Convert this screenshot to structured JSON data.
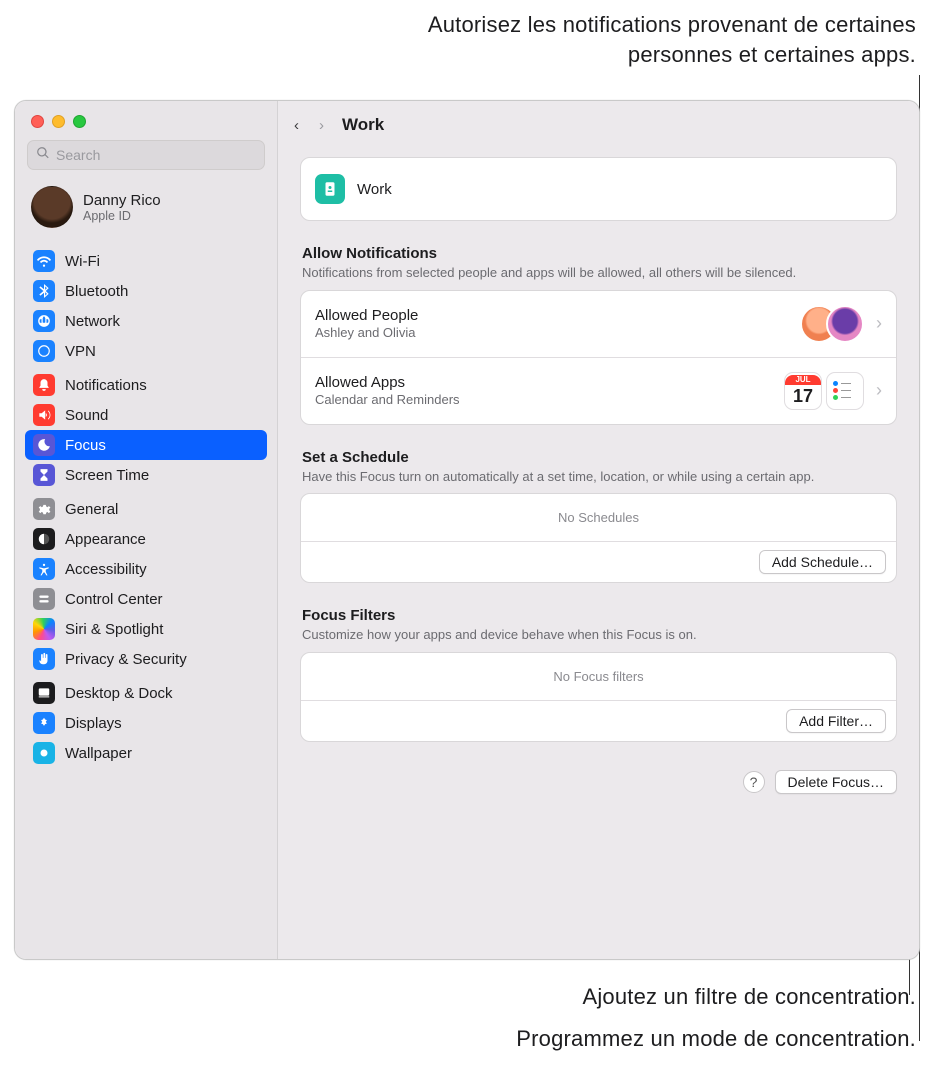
{
  "callouts": {
    "top": "Autorisez les notifications provenant de certaines personnes et certaines apps.",
    "filter": "Ajoutez un filtre de concentration.",
    "schedule": "Programmez un mode de concentration."
  },
  "search": {
    "placeholder": "Search"
  },
  "account": {
    "name": "Danny Rico",
    "sub": "Apple ID"
  },
  "sidebar": {
    "items": [
      {
        "label": "Wi-Fi"
      },
      {
        "label": "Bluetooth"
      },
      {
        "label": "Network"
      },
      {
        "label": "VPN"
      },
      {
        "label": "Notifications"
      },
      {
        "label": "Sound"
      },
      {
        "label": "Focus"
      },
      {
        "label": "Screen Time"
      },
      {
        "label": "General"
      },
      {
        "label": "Appearance"
      },
      {
        "label": "Accessibility"
      },
      {
        "label": "Control Center"
      },
      {
        "label": "Siri & Spotlight"
      },
      {
        "label": "Privacy & Security"
      },
      {
        "label": "Desktop & Dock"
      },
      {
        "label": "Displays"
      },
      {
        "label": "Wallpaper"
      }
    ]
  },
  "topbar": {
    "title": "Work"
  },
  "hero": {
    "title": "Work"
  },
  "allow": {
    "section_title": "Allow Notifications",
    "section_sub": "Notifications from selected people and apps will be allowed, all others will be silenced.",
    "people_title": "Allowed People",
    "people_sub": "Ashley and Olivia",
    "apps_title": "Allowed Apps",
    "apps_sub": "Calendar and Reminders",
    "calendar_month": "JUL",
    "calendar_day": "17"
  },
  "schedule": {
    "section_title": "Set a Schedule",
    "section_sub": "Have this Focus turn on automatically at a set time, location, or while using a certain app.",
    "empty": "No Schedules",
    "add_label": "Add Schedule…"
  },
  "filters": {
    "section_title": "Focus Filters",
    "section_sub": "Customize how your apps and device behave when this Focus is on.",
    "empty": "No Focus filters",
    "add_label": "Add Filter…"
  },
  "footer": {
    "help": "?",
    "delete_label": "Delete Focus…"
  }
}
